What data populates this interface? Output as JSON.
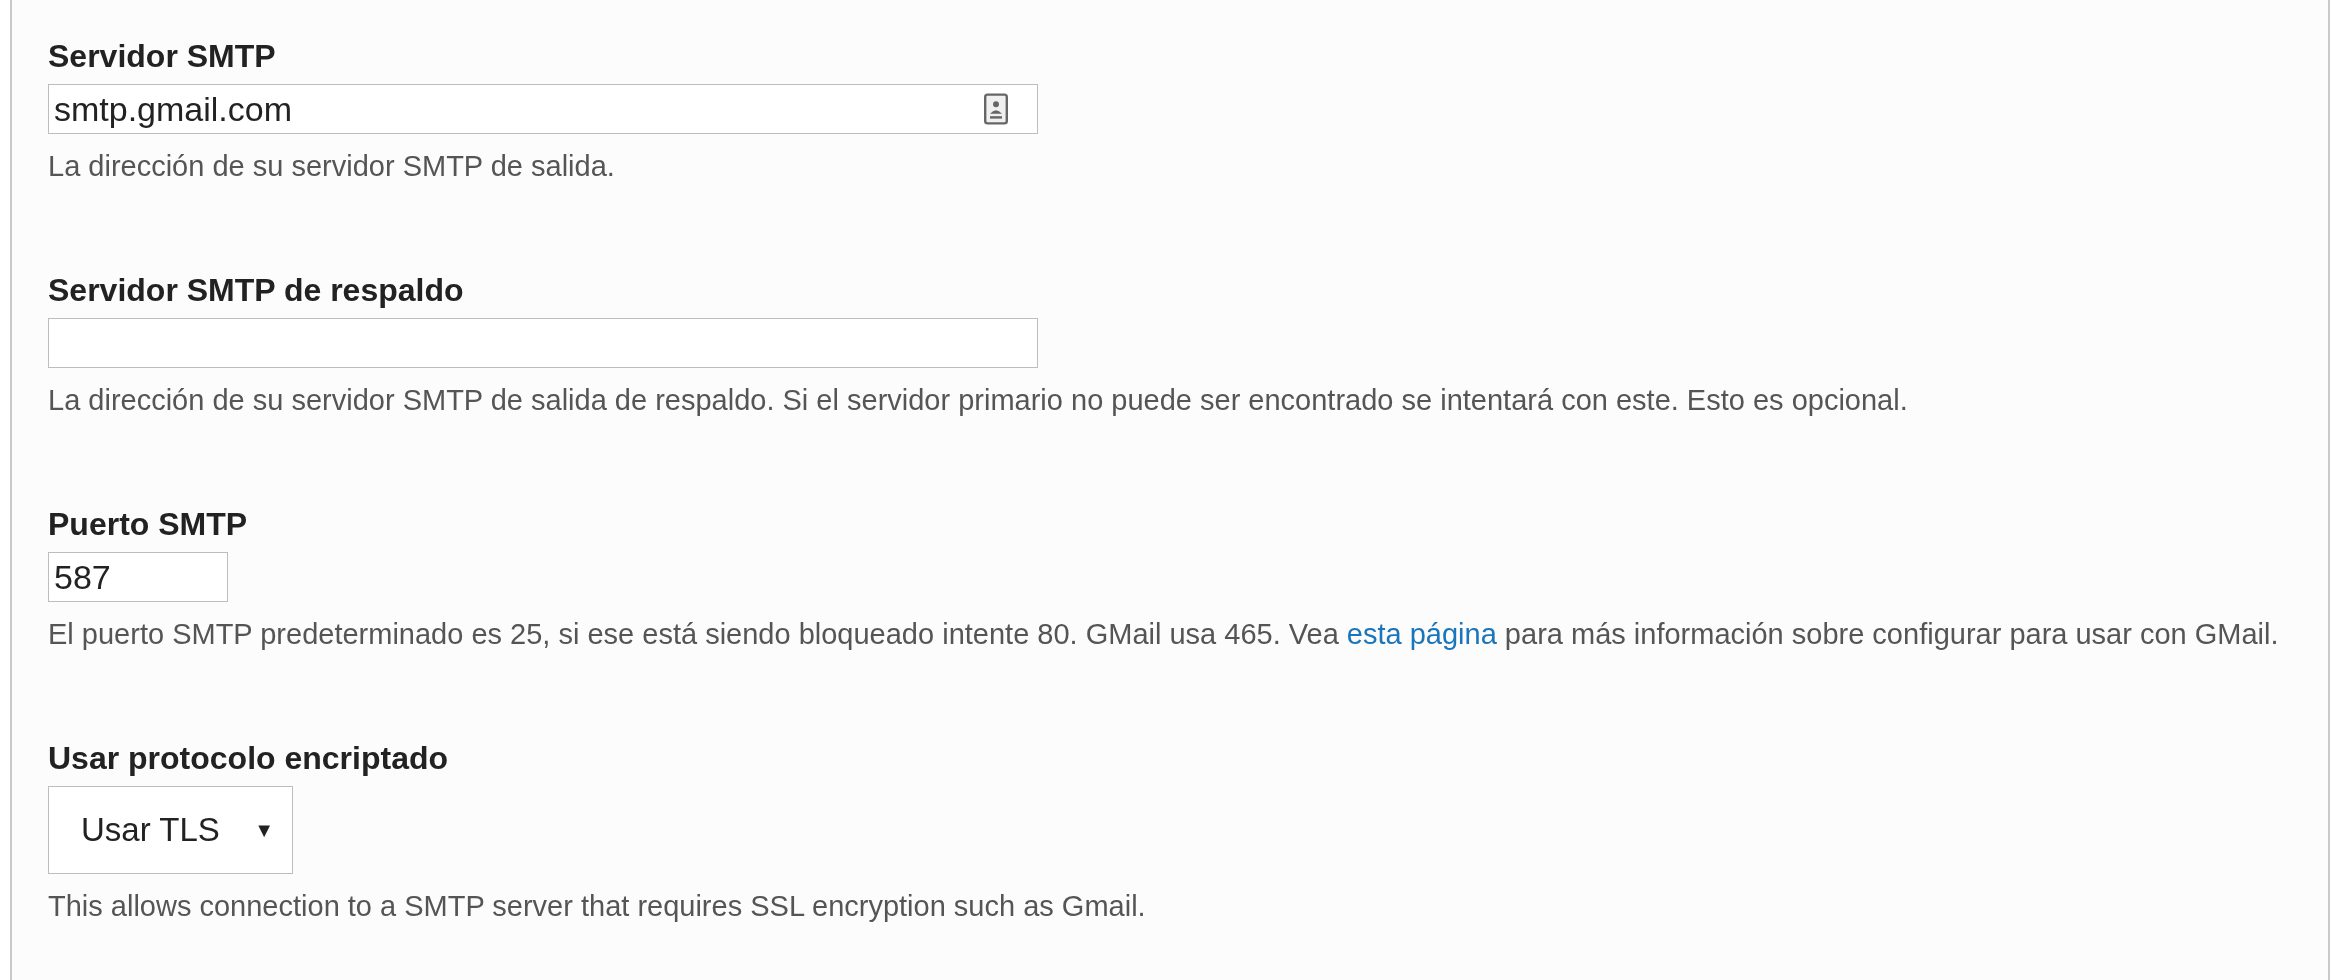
{
  "fields": [
    {
      "kind": "address",
      "label": "Servidor SMTP",
      "value": "smtp.gmail.com",
      "autofill_icon": true,
      "description": "La dirección de su servidor SMTP de salida."
    },
    {
      "kind": "address",
      "label": "Servidor SMTP de respaldo",
      "description": "La dirección de su servidor SMTP de salida de respaldo. Si el servidor primario no puede ser encontrado se intentará con este. Esto es opcional."
    },
    {
      "kind": "port",
      "label": "Puerto SMTP",
      "value": "587",
      "description": "El puerto SMTP predeterminado es 25, si ese está siendo bloqueado intente 80. GMail usa 465. Vea ",
      "link": "esta página",
      "description_after": " para más información sobre configurar para usar con GMail."
    },
    {
      "kind": "select",
      "label": "Usar protocolo encriptado",
      "value": "Usar TLS",
      "arrow": "▼",
      "description": "This allows connection to a SMTP server that requires SSL encryption such as Gmail."
    }
  ]
}
